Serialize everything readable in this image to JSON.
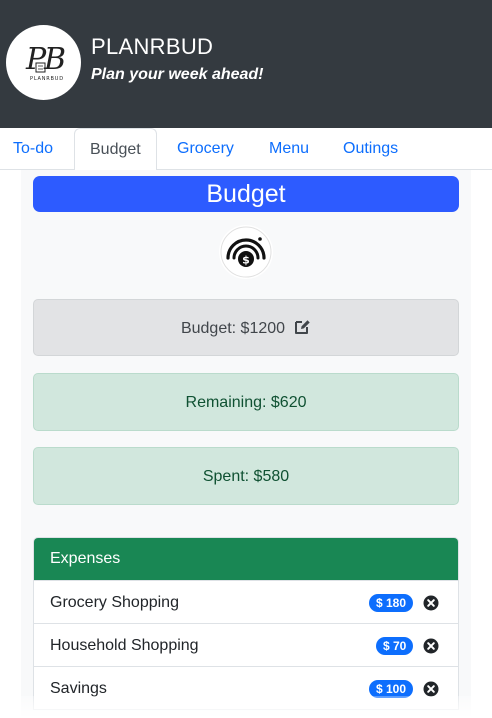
{
  "header": {
    "logo_text": "PB",
    "logo_subtext": "PLANRBUD",
    "title": "PLANRBUD",
    "tagline": "Plan your week ahead!"
  },
  "tabs": [
    {
      "label": "To-do",
      "active": false
    },
    {
      "label": "Budget",
      "active": true
    },
    {
      "label": "Grocery",
      "active": false
    },
    {
      "label": "Menu",
      "active": false
    },
    {
      "label": "Outings",
      "active": false
    }
  ],
  "budget": {
    "heading": "Budget",
    "icon": "budget-gauge-icon",
    "budget_label": "Budget: $1200",
    "remaining_label": "Remaining: $620",
    "spent_label": "Spent: $580"
  },
  "expenses": {
    "heading": "Expenses",
    "items": [
      {
        "name": "Grocery Shopping",
        "amount": "$ 180"
      },
      {
        "name": "Household Shopping",
        "amount": "$ 70"
      },
      {
        "name": "Savings",
        "amount": "$ 100"
      }
    ]
  },
  "colors": {
    "header_bg": "#343a40",
    "primary": "#0d6efd",
    "budget_banner": "#2d5bff",
    "success": "#198754",
    "success_light": "#d1e7dd",
    "secondary_light": "#e2e3e5"
  }
}
